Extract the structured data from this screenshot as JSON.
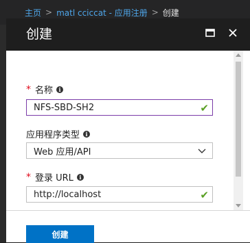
{
  "breadcrumb": {
    "home": "主页",
    "app": "matl cciccat - 应用注册",
    "current": "创建",
    "separator": ">"
  },
  "panel": {
    "title": "创建",
    "maximize_icon": "maximize-icon",
    "close_icon": "close-icon"
  },
  "form": {
    "name": {
      "label": "名称",
      "value": "NFS-SBD-SH2",
      "required": true
    },
    "app_type": {
      "label": "应用程序类型",
      "value": "Web 应用/API"
    },
    "signon_url": {
      "label": "登录 URL",
      "value": "http://localhost",
      "required": true
    }
  },
  "actions": {
    "create_label": "创建"
  },
  "colors": {
    "accent": "#0072c6",
    "valid": "#5aa024",
    "required": "#e00b1c",
    "focus": "#7a3aa8"
  }
}
